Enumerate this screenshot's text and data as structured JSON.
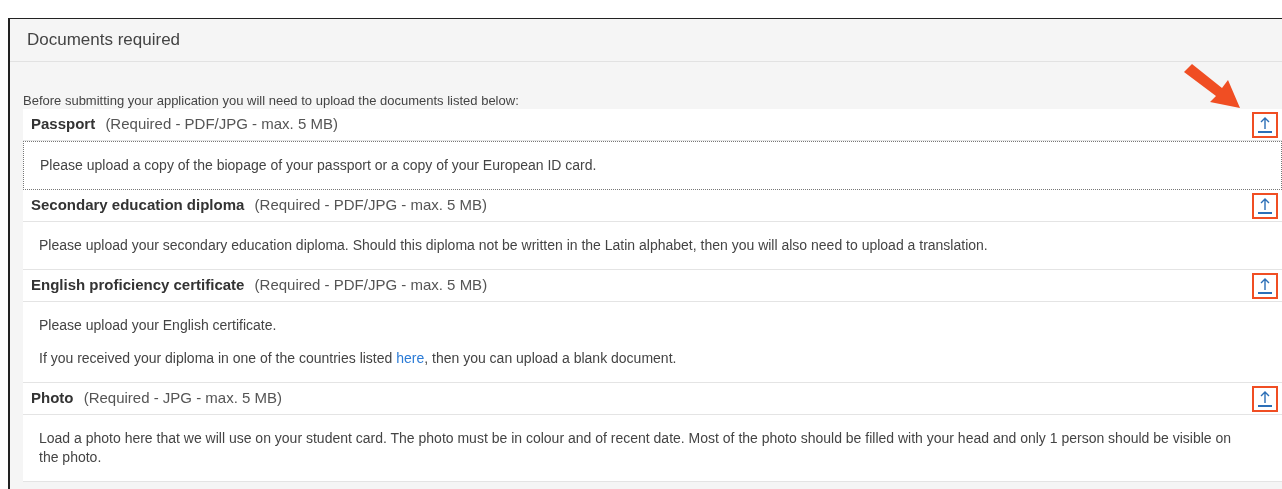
{
  "panel": {
    "title": "Documents required",
    "intro": "Before submitting your application you will need to upload the documents listed below:"
  },
  "documents": [
    {
      "name": "Passport",
      "requirements": "(Required - PDF/JPG - max. 5 MB)",
      "focused": true,
      "highlighted": true,
      "paragraphs": [
        [
          {
            "kind": "text",
            "text": "Please upload a copy of the biopage of your passport or a copy of your European ID card."
          }
        ]
      ]
    },
    {
      "name": "Secondary education diploma",
      "requirements": "(Required - PDF/JPG - max. 5 MB)",
      "focused": false,
      "highlighted": true,
      "paragraphs": [
        [
          {
            "kind": "text",
            "text": "Please upload your secondary education diploma. Should this diploma not be written in the Latin alphabet, then you will also need to upload a translation."
          }
        ]
      ]
    },
    {
      "name": "English proficiency certificate",
      "requirements": "(Required - PDF/JPG - max. 5 MB)",
      "focused": false,
      "highlighted": true,
      "paragraphs": [
        [
          {
            "kind": "text",
            "text": "Please upload your English certificate."
          }
        ],
        [
          {
            "kind": "text",
            "text": "If you received your diploma in one of the countries listed "
          },
          {
            "kind": "link",
            "text": "here"
          },
          {
            "kind": "text",
            "text": ", then you can upload a blank document."
          }
        ]
      ]
    },
    {
      "name": "Photo",
      "requirements": "(Required - JPG - max. 5 MB)",
      "focused": false,
      "highlighted": true,
      "paragraphs": [
        [
          {
            "kind": "text",
            "text": "Load a photo here that we will use on your student card. The photo must be in colour and of recent date. Most of the photo should be filled with your head and only 1 person should be visible on the photo."
          }
        ]
      ]
    }
  ]
}
